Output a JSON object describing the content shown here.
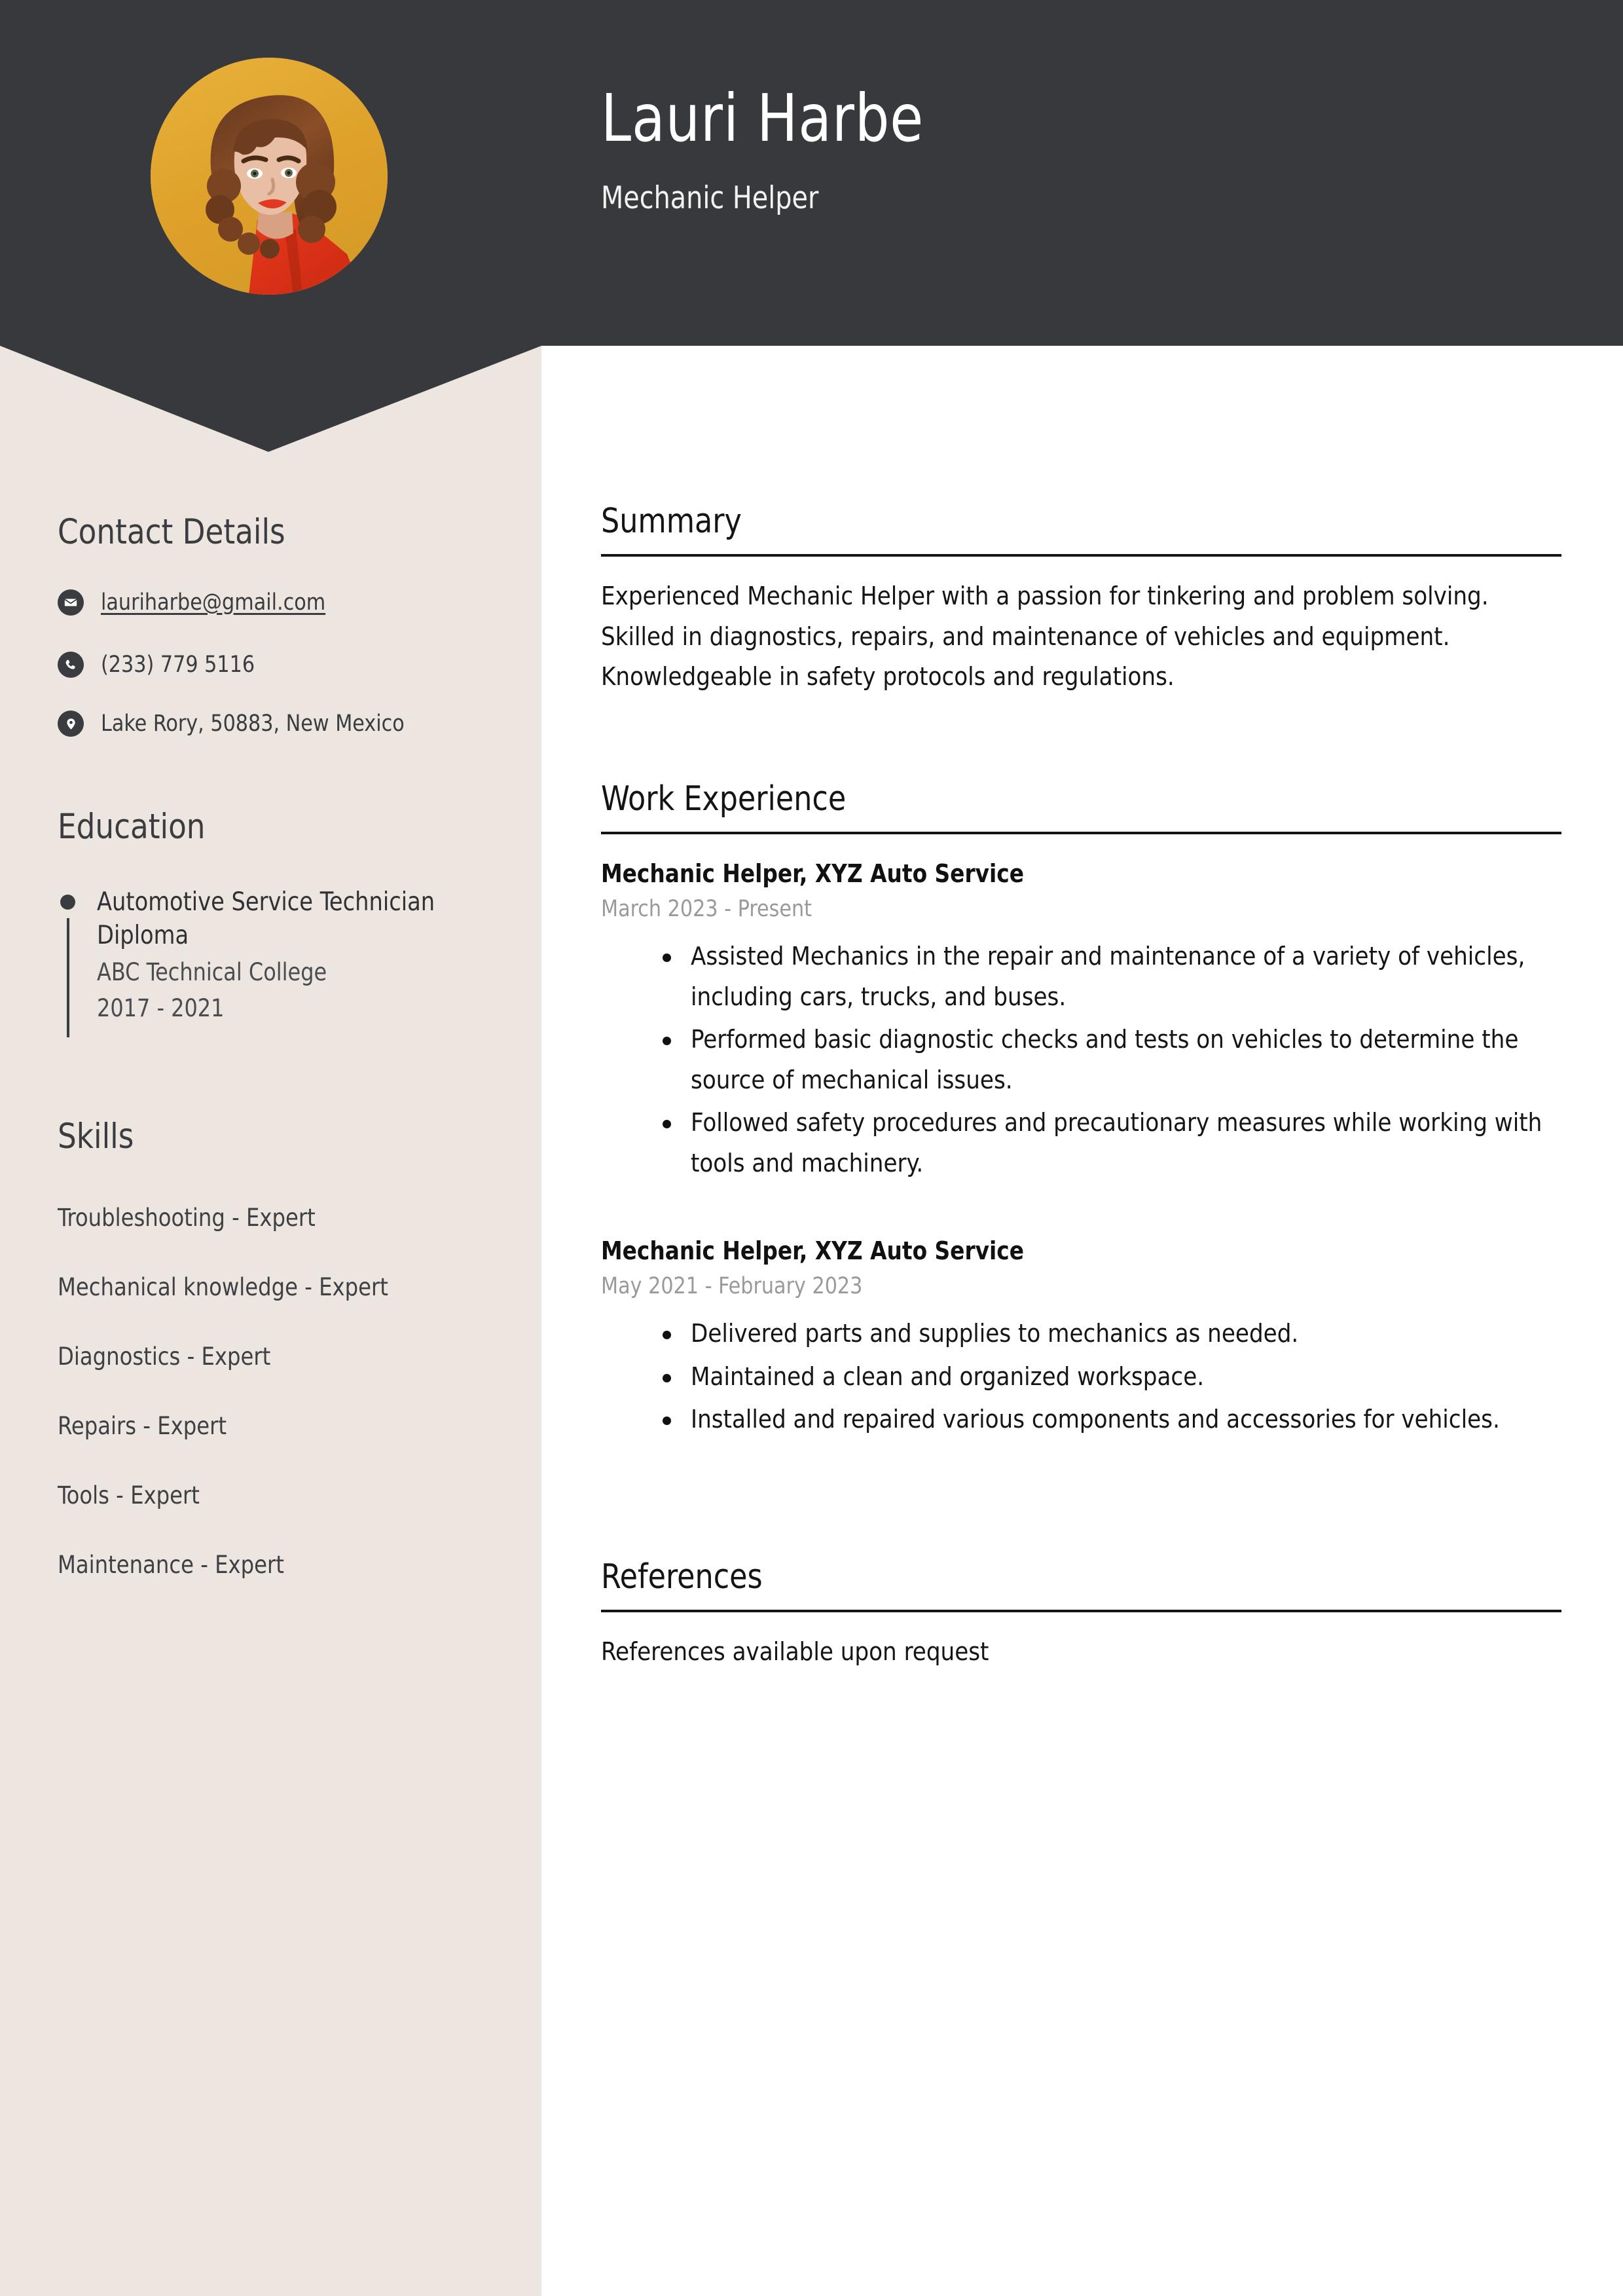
{
  "colors": {
    "header_bg": "#37393D",
    "sidebar_bg": "#EDE5E0",
    "main_bg": "#FFFFFF",
    "photo_bg": "#E0A52E",
    "text_dark": "#3A3C40",
    "date_grey": "#9A9A9A",
    "rule": "#141414"
  },
  "header": {
    "name": "Lauri Harbe",
    "job_title": "Mechanic Helper",
    "avatar_alt": "portrait-photo"
  },
  "sidebar": {
    "contact": {
      "heading": "Contact Details",
      "items": [
        {
          "icon": "envelope-icon",
          "value": "lauriharbe@gmail.com",
          "is_link": true
        },
        {
          "icon": "phone-icon",
          "value": "(233) 779 5116",
          "is_link": false
        },
        {
          "icon": "location-pin-icon",
          "value": "Lake Rory, 50883, New Mexico",
          "is_link": false
        }
      ]
    },
    "education": {
      "heading": "Education",
      "items": [
        {
          "degree": "Automotive Service Technician Diploma",
          "school": "ABC Technical College",
          "dates": "2017 - 2021"
        }
      ]
    },
    "skills": {
      "heading": "Skills",
      "items": [
        "Troubleshooting - Expert",
        "Mechanical knowledge - Expert",
        "Diagnostics - Expert",
        "Repairs - Expert",
        "Tools - Expert",
        "Maintenance - Expert"
      ]
    }
  },
  "main": {
    "summary": {
      "heading": "Summary",
      "text": "Experienced Mechanic Helper with a passion for tinkering and problem solving. Skilled in diagnostics, repairs, and maintenance of vehicles and equipment. Knowledgeable in safety protocols and regulations."
    },
    "work_experience": {
      "heading": "Work Experience",
      "jobs": [
        {
          "title": "Mechanic Helper, XYZ Auto Service",
          "dates": "March 2023 - Present",
          "bullets": [
            "Assisted Mechanics in the repair and maintenance of a variety of vehicles, including cars, trucks, and buses.",
            "Performed basic diagnostic checks and tests on vehicles to determine the source of mechanical issues.",
            "Followed safety procedures and precautionary measures while working with tools and machinery."
          ]
        },
        {
          "title": "Mechanic Helper, XYZ Auto Service",
          "dates": "May 2021 - February 2023",
          "bullets": [
            "Delivered parts and supplies to mechanics as needed.",
            "Maintained a clean and organized workspace.",
            "Installed and repaired various components and accessories for vehicles."
          ]
        }
      ]
    },
    "references": {
      "heading": "References",
      "text": "References available upon request"
    }
  }
}
